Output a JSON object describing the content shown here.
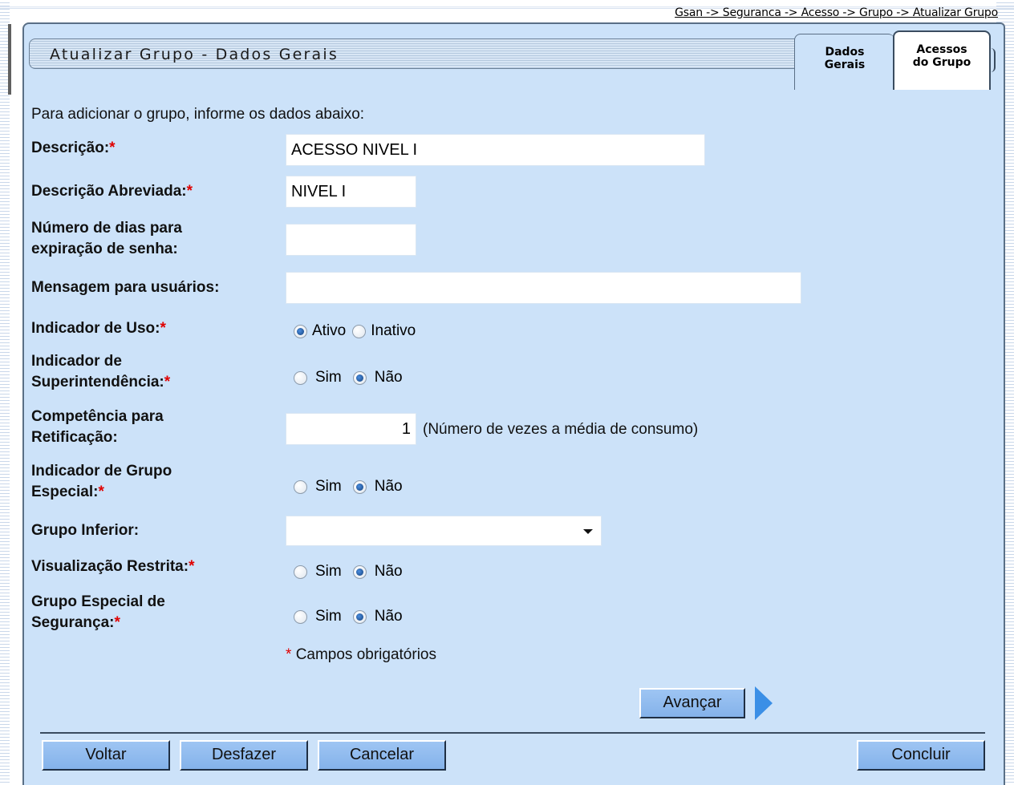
{
  "breadcrumb": "Gsan -> Seguranca -> Acesso -> Grupo -> Atualizar Grupo",
  "page": {
    "title": "Atualizar Grupo - Dados Gerais",
    "tabs": [
      {
        "line1": "Dados",
        "line2": "Gerais",
        "active": true
      },
      {
        "line1": "Acessos",
        "line2": "do Grupo",
        "active": false
      }
    ],
    "intro": "Para adicionar o grupo, informe os dados abaixo:"
  },
  "form": {
    "required_mark": "*",
    "descricao": {
      "label": "Descrição:",
      "value": "ACESSO NIVEL I"
    },
    "descricao_abreviada": {
      "label": "Descrição Abreviada:",
      "value": "NIVEL I"
    },
    "dias_expiracao": {
      "label_line1": "Número de dias para",
      "label_line2": "expiração de senha:",
      "value": ""
    },
    "mensagem": {
      "label": "Mensagem para usuários:",
      "value": ""
    },
    "indicador_uso": {
      "label": "Indicador de Uso:",
      "option1": "Ativo",
      "option2": "Inativo",
      "selected": "Ativo"
    },
    "superintendencia": {
      "label_line1": "Indicador de",
      "label_line2": "Superintendência:",
      "option1": "Sim",
      "option2": "Não",
      "selected": "Não"
    },
    "competencia": {
      "label_line1": "Competência para",
      "label_line2": "Retificação:",
      "value": "1",
      "hint": "(Número de vezes a média de consumo)"
    },
    "grupo_especial": {
      "label_line1": "Indicador de Grupo",
      "label_line2": "Especial:",
      "option1": "Sim",
      "option2": "Não",
      "selected": "Não"
    },
    "grupo_inferior": {
      "label": "Grupo Inferior:",
      "value": ""
    },
    "visualizacao_restrita": {
      "label": "Visualização Restrita:",
      "option1": "Sim",
      "option2": "Não",
      "selected": "Não"
    },
    "grupo_seguranca": {
      "label_line1": "Grupo Especial de",
      "label_line2": "Segurança:",
      "option1": "Sim",
      "option2": "Não",
      "selected": "Não"
    },
    "required_note": "Campos obrigatórios"
  },
  "buttons": {
    "avancar": "Avançar",
    "voltar": "Voltar",
    "desfazer": "Desfazer",
    "cancelar": "Cancelar",
    "concluir": "Concluir"
  },
  "colors": {
    "panel_background": "#cce2f9",
    "button": "#8fbcf0",
    "required": "#e00000",
    "next_arrow": "#3b8fe6"
  },
  "icons": {
    "next": "next-arrow-icon",
    "dropdown": "chevron-down-icon"
  }
}
